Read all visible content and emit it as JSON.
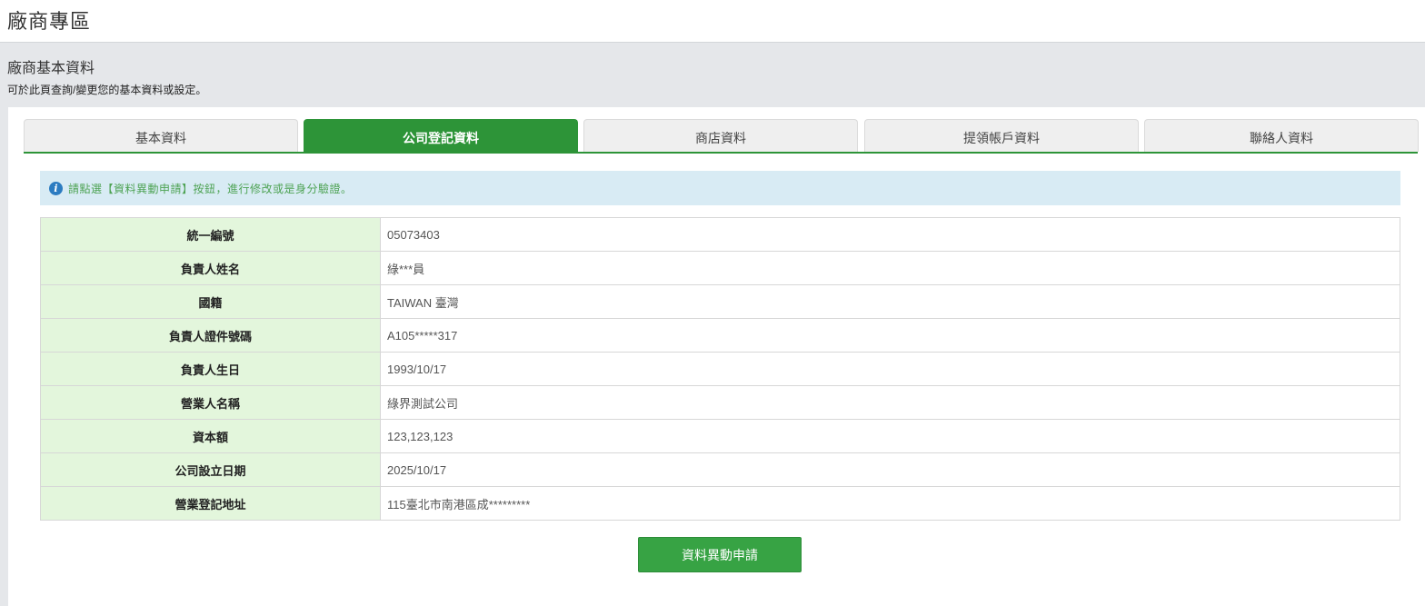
{
  "page": {
    "title": "廠商專區"
  },
  "section": {
    "title": "廠商基本資料",
    "description": "可於此頁查詢/變更您的基本資料或設定。"
  },
  "tabs": [
    {
      "label": "基本資料",
      "active": false
    },
    {
      "label": "公司登記資料",
      "active": true
    },
    {
      "label": "商店資料",
      "active": false
    },
    {
      "label": "提領帳戶資料",
      "active": false
    },
    {
      "label": "聯絡人資料",
      "active": false
    }
  ],
  "notice": {
    "icon": "info-icon",
    "text": "請點選【資料異動申請】按鈕，進行修改或是身分驗證。"
  },
  "rows": [
    {
      "label": "統一編號",
      "value": "05073403"
    },
    {
      "label": "負責人姓名",
      "value": "綠***員"
    },
    {
      "label": "國籍",
      "value": "TAIWAN 臺灣"
    },
    {
      "label": "負責人證件號碼",
      "value": "A105*****317"
    },
    {
      "label": "負責人生日",
      "value": "1993/10/17"
    },
    {
      "label": "營業人名稱",
      "value": "綠界測試公司"
    },
    {
      "label": "資本額",
      "value": "123,123,123"
    },
    {
      "label": "公司設立日期",
      "value": "2025/10/17"
    },
    {
      "label": "營業登記地址",
      "value": "115臺北市南港區成*********"
    }
  ],
  "apply_button": {
    "label": "資料異動申請"
  },
  "colors": {
    "accent": "#2d9438",
    "label_bg": "#e3f6dc",
    "notice_bg": "#d8ebf4"
  }
}
